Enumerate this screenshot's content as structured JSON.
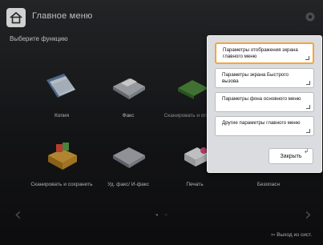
{
  "header": {
    "title": "Главное меню"
  },
  "main": {
    "subtitle": "Выберите функцию",
    "functions": [
      {
        "label": "Копия",
        "icon": "copy-icon"
      },
      {
        "label": "Факс",
        "icon": "fax-icon"
      },
      {
        "label": "Сканировать и отправить",
        "icon": "scan-send-icon"
      },
      {
        "label": "",
        "icon": "green-folder-icon"
      },
      {
        "label": "Сканировать и сохранить",
        "icon": "scan-store-icon"
      },
      {
        "label": "Уд. факс/ И-факс",
        "icon": "remote-fax-icon"
      },
      {
        "label": "Печать",
        "icon": "print-icon"
      },
      {
        "label": "Безопасн",
        "icon": "secure-print-icon"
      }
    ],
    "logout_label": "Выход из сист."
  },
  "dialog": {
    "options": [
      {
        "label": "Параметры отображения экрана главного меню",
        "selected": true
      },
      {
        "label": "Параметры экрана Быстрого вызова",
        "selected": false
      },
      {
        "label": "Параметры фона основного меню",
        "selected": false
      },
      {
        "label": "Другие параметры главного меню",
        "selected": false
      }
    ],
    "close_label": "Закрыть"
  },
  "colors": {
    "highlight": "#f6a53a",
    "dialog_bg": "#dadcdf"
  }
}
